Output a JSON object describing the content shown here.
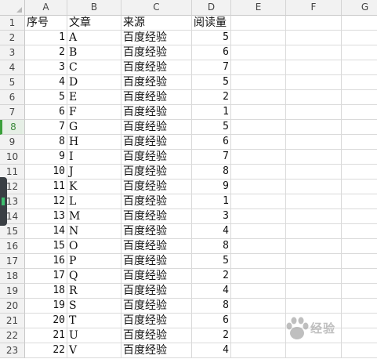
{
  "columns": [
    "A",
    "B",
    "C",
    "D",
    "E",
    "F",
    "G"
  ],
  "header_row": {
    "row": "1",
    "a": "序号",
    "b": "文章",
    "c": "来源",
    "d": "阅读量"
  },
  "rows": [
    {
      "row": "2",
      "a": "1",
      "b": "A",
      "c": "百度经验",
      "d": "5"
    },
    {
      "row": "3",
      "a": "2",
      "b": "B",
      "c": "百度经验",
      "d": "6"
    },
    {
      "row": "4",
      "a": "3",
      "b": "C",
      "c": "百度经验",
      "d": "7"
    },
    {
      "row": "5",
      "a": "4",
      "b": "D",
      "c": "百度经验",
      "d": "5"
    },
    {
      "row": "6",
      "a": "5",
      "b": "E",
      "c": "百度经验",
      "d": "2"
    },
    {
      "row": "7",
      "a": "6",
      "b": "F",
      "c": "百度经验",
      "d": "1"
    },
    {
      "row": "8",
      "a": "7",
      "b": "G",
      "c": "百度经验",
      "d": "5"
    },
    {
      "row": "9",
      "a": "8",
      "b": "H",
      "c": "百度经验",
      "d": "6"
    },
    {
      "row": "10",
      "a": "9",
      "b": "I",
      "c": "百度经验",
      "d": "7"
    },
    {
      "row": "11",
      "a": "10",
      "b": "J",
      "c": "百度经验",
      "d": "8"
    },
    {
      "row": "12",
      "a": "11",
      "b": "K",
      "c": "百度经验",
      "d": "9"
    },
    {
      "row": "13",
      "a": "12",
      "b": "L",
      "c": "百度经验",
      "d": "1"
    },
    {
      "row": "14",
      "a": "13",
      "b": "M",
      "c": "百度经验",
      "d": "3"
    },
    {
      "row": "15",
      "a": "14",
      "b": "N",
      "c": "百度经验",
      "d": "4"
    },
    {
      "row": "16",
      "a": "15",
      "b": "O",
      "c": "百度经验",
      "d": "8"
    },
    {
      "row": "17",
      "a": "16",
      "b": "P",
      "c": "百度经验",
      "d": "5"
    },
    {
      "row": "18",
      "a": "17",
      "b": "Q",
      "c": "百度经验",
      "d": "2"
    },
    {
      "row": "19",
      "a": "18",
      "b": "R",
      "c": "百度经验",
      "d": "4"
    },
    {
      "row": "20",
      "a": "19",
      "b": "S",
      "c": "百度经验",
      "d": "8"
    },
    {
      "row": "21",
      "a": "20",
      "b": "T",
      "c": "百度经验",
      "d": "6"
    },
    {
      "row": "22",
      "a": "21",
      "b": "U",
      "c": "百度经验",
      "d": "2"
    },
    {
      "row": "23",
      "a": "22",
      "b": "V",
      "c": "百度经验",
      "d": "4"
    }
  ],
  "active_row": "8",
  "icons": {
    "corner": "select-all-icon",
    "side_tab": "side-panel-handle-icon",
    "watermark": "baidu-paw-logo-icon"
  },
  "watermark_text": "经验",
  "colors": {
    "header_bg": "#f2f2f2",
    "grid": "#dadada",
    "active_row": "#3aa03a",
    "side_tab": "#3a3f44"
  }
}
